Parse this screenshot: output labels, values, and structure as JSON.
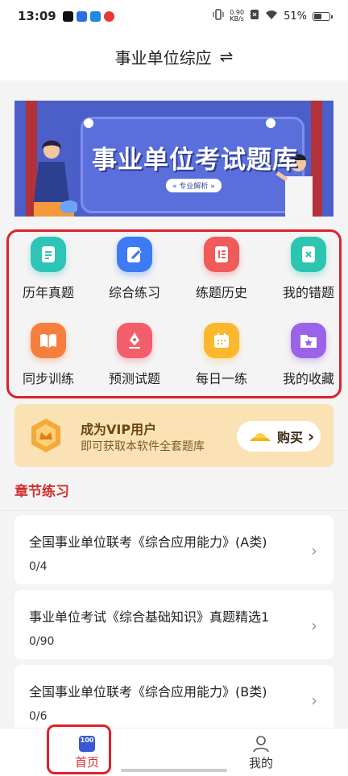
{
  "status_bar": {
    "time": "13:09",
    "net_speed_value": "0.90",
    "net_speed_unit": "KB/s",
    "battery": "51%"
  },
  "header": {
    "title": "事业单位综应",
    "swap_glyph": "⇌"
  },
  "banner": {
    "title": "事业单位考试题库",
    "tag": "« 专业解析 »"
  },
  "quick_grid": [
    {
      "label": "历年真题",
      "icon": "document-icon",
      "color": "#2ec4b6"
    },
    {
      "label": "综合练习",
      "icon": "edit-icon",
      "color": "#3d7bf5"
    },
    {
      "label": "练题历史",
      "icon": "notebook-icon",
      "color": "#f05a5a"
    },
    {
      "label": "我的错题",
      "icon": "error-book-icon",
      "color": "#2cc6b0"
    },
    {
      "label": "同步训练",
      "icon": "open-book-icon",
      "color": "#f5803e"
    },
    {
      "label": "预测试题",
      "icon": "pen-icon",
      "color": "#f25f6a"
    },
    {
      "label": "每日一练",
      "icon": "calendar-icon",
      "color": "#fbb82d"
    },
    {
      "label": "我的收藏",
      "icon": "star-folder-icon",
      "color": "#9a63e8"
    }
  ],
  "vip": {
    "title": "成为VIP用户",
    "subtitle": "即可获取本软件全套题库",
    "buy_label": "购买",
    "buy_chevron": "›"
  },
  "section": {
    "title": "章节练习"
  },
  "chapters": [
    {
      "title": "全国事业单位联考《综合应用能力》(A类)",
      "progress": "0/4"
    },
    {
      "title": "事业单位考试《综合基础知识》真题精选1",
      "progress": "0/90"
    },
    {
      "title": "全国事业单位联考《综合应用能力》(B类)",
      "progress": "0/6"
    }
  ],
  "chapter_arrow": "›",
  "tabbar": {
    "home_label": "首页",
    "home_icon_text": "100",
    "mine_label": "我的"
  }
}
